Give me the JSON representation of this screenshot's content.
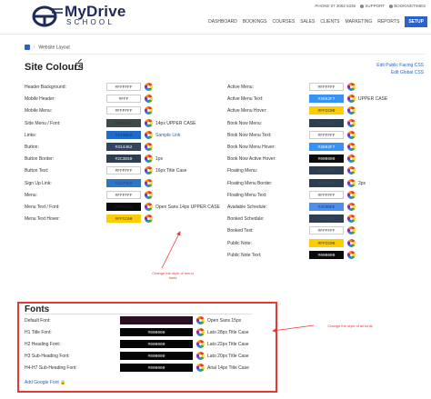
{
  "brand": {
    "name_top": "MyDrive",
    "name_bottom": "SCHOOL",
    "color": "#1f2b5b"
  },
  "topbar": {
    "phone": "PHONE 07 3062 6336",
    "support": "SUPPORT",
    "account": "BOOKINGTIMES"
  },
  "nav": [
    "DASHBOARD",
    "BOOKINGS",
    "COURSES",
    "SALES",
    "CLIENTS",
    "MARKETING",
    "REPORTS",
    "SETUP"
  ],
  "nav_active": "SETUP",
  "breadcrumb": {
    "current": "Website Layout"
  },
  "page_title": "Site Colours",
  "links": {
    "edit_public": "Edit Public Facing CSS",
    "edit_global": "Edit Global CSS"
  },
  "left_colors": [
    {
      "label": "Header Background:",
      "value": "#FFFFFF",
      "bg": "#ffffff",
      "fg": "#333333",
      "extra": ""
    },
    {
      "label": "Mobile Header:",
      "value": "#FFF",
      "bg": "#ffffff",
      "fg": "#333333",
      "extra": ""
    },
    {
      "label": "Mobile Menu:",
      "value": "#FFFFFF",
      "bg": "#ffffff",
      "fg": "#333333",
      "extra": ""
    },
    {
      "label": "Side Menu / Font:",
      "value": "#3E4A4A",
      "bg": "#3e4a4a",
      "fg": "#333333",
      "extra": "14px UPPER CASE"
    },
    {
      "label": "Links:",
      "value": "#1E6BC9",
      "bg": "#1e6bc9",
      "fg": "#0f3d7a",
      "extra": "Sample Link",
      "extra_link": true
    },
    {
      "label": "Button:",
      "value": "#314462",
      "bg": "#314462",
      "fg": "#ffffff",
      "extra": ""
    },
    {
      "label": "Button Border:",
      "value": "#2C3E50",
      "bg": "#2c3e50",
      "fg": "#ffffff",
      "extra": "1px"
    },
    {
      "label": "Button Text:",
      "value": "#FFFFFF",
      "bg": "#ffffff",
      "fg": "#333333",
      "extra": "16px Title Case"
    },
    {
      "label": "Sign Up Link:",
      "value": "#2C75C9",
      "bg": "#2c75c9",
      "fg": "#1a4a80",
      "extra": ""
    },
    {
      "label": "Menu:",
      "value": "#FFFFFF",
      "bg": "#ffffff",
      "fg": "#333333",
      "extra": ""
    },
    {
      "label": "Menu Text / Font:",
      "value": "#000000",
      "bg": "#0a0a0a",
      "fg": "#222222",
      "extra": "Open Sans 14px UPPER CASE"
    },
    {
      "label": "Menu Text Hover:",
      "value": "#FFCC00",
      "bg": "#ffcc00",
      "fg": "#333333",
      "extra": ""
    }
  ],
  "right_colors": [
    {
      "label": "Active Menu:",
      "value": "#FFFFFF",
      "bg": "#ffffff",
      "fg": "#333333",
      "extra": ""
    },
    {
      "label": "Active Menu Text:",
      "value": "#3692F7",
      "bg": "#3692f7",
      "fg": "#ffffff",
      "extra": "UPPER CASE"
    },
    {
      "label": "Active Menu Hover:",
      "value": "#FFCC00",
      "bg": "#ffcc00",
      "fg": "#333333",
      "extra": ""
    },
    {
      "label": "Book Now Menu:",
      "value": "#2C3E50",
      "bg": "#2c3e50",
      "fg": "#3a4f66",
      "extra": ""
    },
    {
      "label": "Book Now Menu Text:",
      "value": "#FFFFFF",
      "bg": "#ffffff",
      "fg": "#333333",
      "extra": ""
    },
    {
      "label": "Book Now Menu Hover:",
      "value": "#3692F7",
      "bg": "#3692f7",
      "fg": "#ffffff",
      "extra": ""
    },
    {
      "label": "Book Now Active Hover:",
      "value": "#000000",
      "bg": "#0a0a0a",
      "fg": "#ffffff",
      "extra": ""
    },
    {
      "label": "Floating Menu:",
      "value": "#2C3E50",
      "bg": "#2c3e50",
      "fg": "#3a4f66",
      "extra": ""
    },
    {
      "label": "Floating Menu Border:",
      "value": "#2C3E50",
      "bg": "#2c3e50",
      "fg": "#3a4f66",
      "extra": "2px"
    },
    {
      "label": "Floating Menu Text:",
      "value": "#FFFFFF",
      "bg": "#ffffff",
      "fg": "#333333",
      "extra": ""
    },
    {
      "label": "Available Schedule:",
      "value": "#4C8DEE",
      "bg": "#4c8dee",
      "fg": "#1a3d7a",
      "extra": ""
    },
    {
      "label": "Booked Schedule:",
      "value": "#2C3E50",
      "bg": "#2c3e50",
      "fg": "#3a4f66",
      "extra": ""
    },
    {
      "label": "Booked Text:",
      "value": "#FFFFFF",
      "bg": "#ffffff",
      "fg": "#333333",
      "extra": ""
    },
    {
      "label": "Public Note:",
      "value": "#FFCC00",
      "bg": "#ffcc00",
      "fg": "#333333",
      "extra": ""
    },
    {
      "label": "Public Note Text:",
      "value": "#000000",
      "bg": "#0a0a0a",
      "fg": "#ffffff",
      "extra": ""
    }
  ],
  "fonts": {
    "title": "Fonts",
    "rows": [
      {
        "label": "Default Font:",
        "value": "",
        "bg": "#2a0f22",
        "fg": "#ffffff",
        "extra": "Open Sans 15px"
      },
      {
        "label": "H1 Title Font:",
        "value": "#000000",
        "bg": "#050505",
        "fg": "#ffffff",
        "extra": "Lato 28px Title Case"
      },
      {
        "label": "H2 Heading Font:",
        "value": "#000000",
        "bg": "#050505",
        "fg": "#ffffff",
        "extra": "Lato 22px Title Case"
      },
      {
        "label": "H3 Sub-Heading Font:",
        "value": "#000000",
        "bg": "#050505",
        "fg": "#ffffff",
        "extra": "Lato 20px Title Case"
      },
      {
        "label": "H4-H7 Sub-Heading Font:",
        "value": "#000000",
        "bg": "#050505",
        "fg": "#ffffff",
        "extra": "Arial 14px Title Case"
      }
    ],
    "add_link": "Add Google Font"
  },
  "annotations": {
    "menu_note": "Change the style of menu fonts",
    "fonts_note": "Change the style of all fonts",
    "color": "#e53935"
  }
}
